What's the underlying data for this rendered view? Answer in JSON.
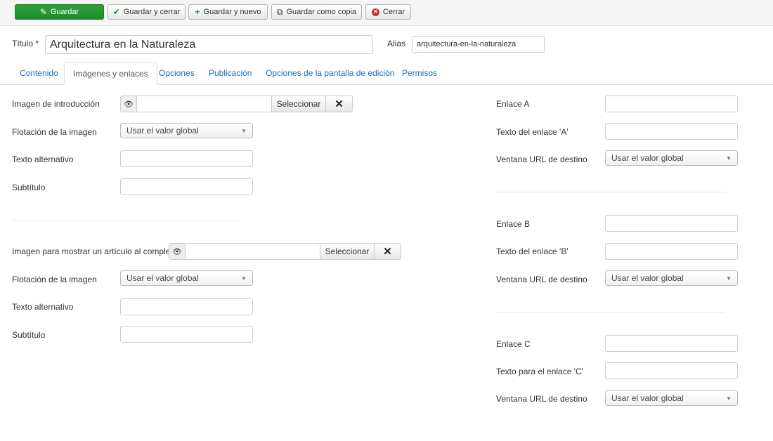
{
  "toolbar": {
    "save": "Guardar",
    "save_close": "Guardar y cerrar",
    "save_new": "Guardar y nuevo",
    "save_copy": "Guardar como copia",
    "close": "Cerrar"
  },
  "header": {
    "title_label": "Título *",
    "title_value": "Arquitectura en la Naturaleza",
    "alias_label": "Alias",
    "alias_value": "arquitectura-en-la-naturaleza"
  },
  "tabs": [
    "Contenido",
    "Imágenes y enlaces",
    "Opciones",
    "Publicación",
    "Opciones de la pantalla de edición",
    "Permisos"
  ],
  "active_tab": "Imágenes y enlaces",
  "intro_image": {
    "label": "Imagen de introducción",
    "select_label": "Seleccionar",
    "float_label": "Flotación de la imagen",
    "float_value": "Usar el valor global",
    "alt_label": "Texto alternativo",
    "caption_label": "Subtítulo"
  },
  "full_image": {
    "label": "Imagen para mostrar un artículo al completo",
    "select_label": "Seleccionar",
    "float_label": "Flotación de la imagen",
    "float_value": "Usar el valor global",
    "alt_label": "Texto alternativo",
    "caption_label": "Subtítulo"
  },
  "link_a": {
    "label": "Enlace A",
    "text_label": "Texto del enlace 'A'",
    "target_label": "Ventana URL de destino",
    "target_value": "Usar el valor global"
  },
  "link_b": {
    "label": "Enlace B",
    "text_label": "Texto del enlace 'B'",
    "target_label": "Ventana URL de destino",
    "target_value": "Usar el valor global"
  },
  "link_c": {
    "label": "Enlace C",
    "text_label": "Texto para el enlace 'C'",
    "target_label": "Ventana URL de destino",
    "target_value": "Usar el valor global"
  },
  "icons": {
    "save": "edit-icon",
    "save_close": "check-icon",
    "save_new": "plus-icon",
    "save_copy": "copy-icon",
    "close": "close-circle-icon",
    "preview": "eye-icon",
    "clear": "clear-icon"
  },
  "colors": {
    "primary": "#2fa23b",
    "link": "#1a6dbb",
    "danger": "#bd362f"
  }
}
